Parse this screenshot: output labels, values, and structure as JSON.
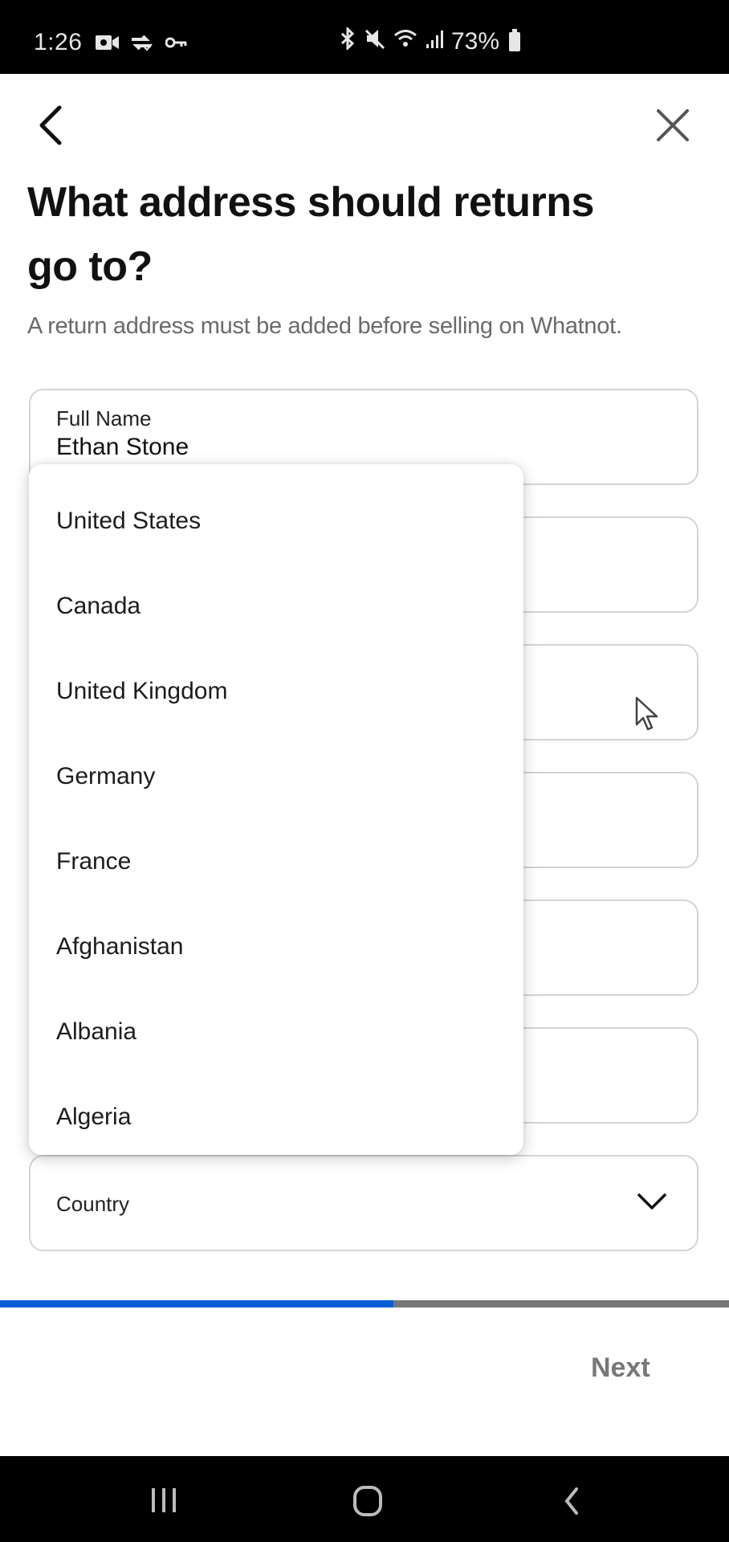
{
  "status_bar": {
    "time": "1:26",
    "left_icons": [
      "video-call-icon",
      "sync-data-icon",
      "vpn-key-icon"
    ],
    "right_icons": [
      "bluetooth-icon",
      "mute-icon",
      "wifi-icon",
      "signal-icon"
    ],
    "battery_percent": "73%"
  },
  "header": {
    "back_icon": "chevron-left-icon",
    "close_icon": "close-icon"
  },
  "page": {
    "title": "What address should returns go to?",
    "subtitle": "A return address must be added before selling on Whatnot."
  },
  "form": {
    "full_name": {
      "label": "Full Name",
      "value": "Ethan Stone"
    },
    "country": {
      "label": "Country",
      "icon": "chevron-down-icon"
    }
  },
  "country_dropdown": {
    "options": [
      "United States",
      "Canada",
      "United Kingdom",
      "Germany",
      "France",
      "Afghanistan",
      "Albania",
      "Algeria"
    ]
  },
  "progress": {
    "fraction": 0.54,
    "fill_color": "#0a5fd6",
    "track_color": "#777777"
  },
  "footer": {
    "next_label": "Next"
  },
  "nav_bar": {
    "recent_apps_icon": "recent-apps-icon",
    "home_icon": "home-icon",
    "back_icon": "back-icon"
  }
}
